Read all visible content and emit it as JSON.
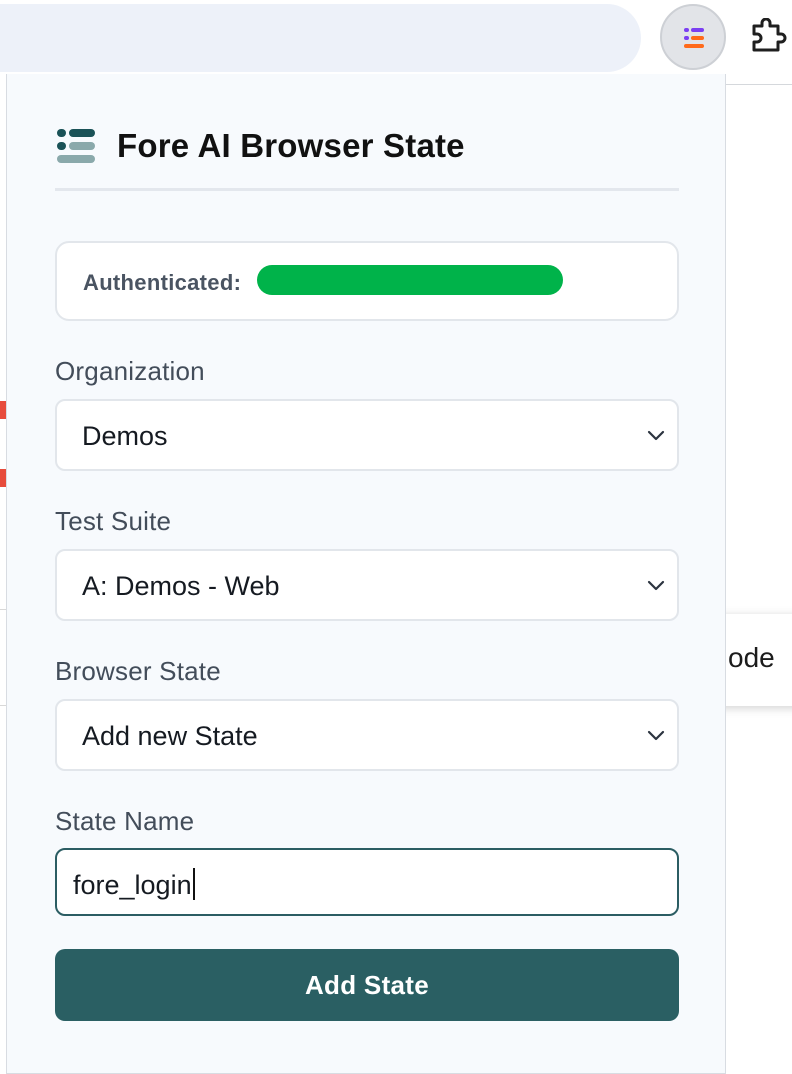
{
  "popup": {
    "title": "Fore AI Browser State",
    "auth_label": "Authenticated:",
    "organization": {
      "label": "Organization",
      "selected": "Demos"
    },
    "test_suite": {
      "label": "Test Suite",
      "selected": "A: Demos - Web"
    },
    "browser_state": {
      "label": "Browser State",
      "selected": "Add new State"
    },
    "state_name": {
      "label": "State Name",
      "value": "fore_login"
    },
    "submit_label": "Add State"
  },
  "background": {
    "tooltip_fragment": "ode"
  },
  "colors": {
    "brand_dark": "#1a5257",
    "brand_light": "#8aa9ab",
    "button": "#2a5f63",
    "redaction": "#00b34a",
    "ext_purple": "#7b3ff2",
    "ext_orange": "#ff6a1a"
  },
  "icons": {
    "extension": "fore-extension-icon",
    "puzzle": "puzzle-icon",
    "logo": "fore-logo-icon",
    "dropdown": "chevron-down-icon"
  }
}
